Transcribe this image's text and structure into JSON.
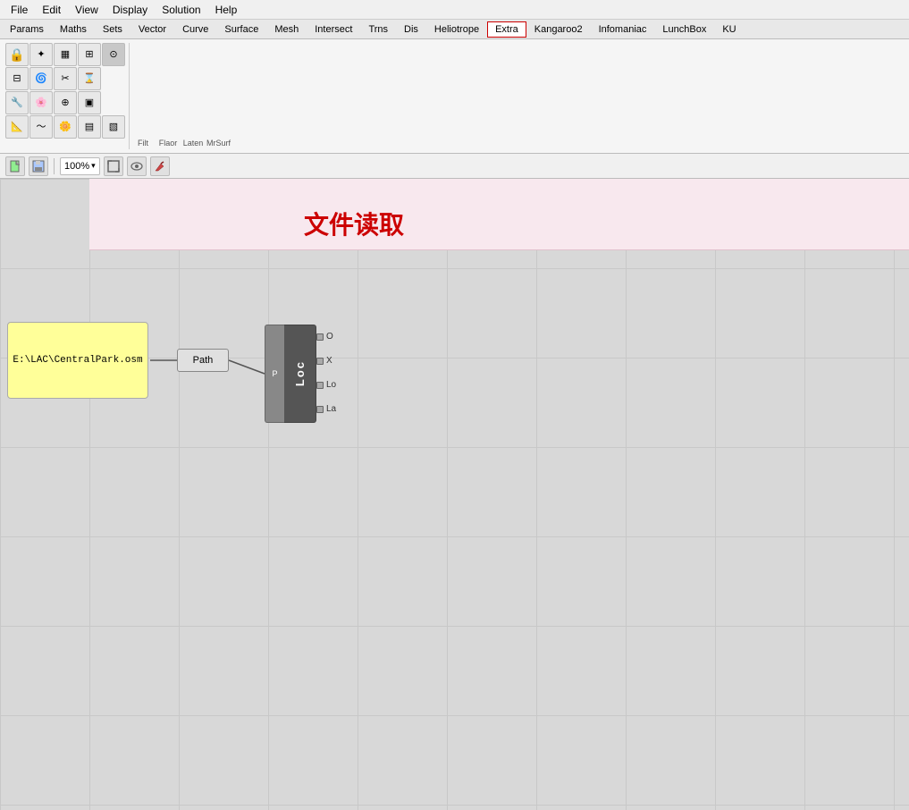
{
  "menu": {
    "items": [
      "File",
      "Edit",
      "View",
      "Display",
      "Solution",
      "Help"
    ]
  },
  "tabs": {
    "items": [
      {
        "label": "Params",
        "active": false
      },
      {
        "label": "Maths",
        "active": false
      },
      {
        "label": "Sets",
        "active": false
      },
      {
        "label": "Vector",
        "active": false
      },
      {
        "label": "Curve",
        "active": false
      },
      {
        "label": "Surface",
        "active": false
      },
      {
        "label": "Mesh",
        "active": false
      },
      {
        "label": "Intersect",
        "active": false
      },
      {
        "label": "Trns",
        "active": false
      },
      {
        "label": "Dis",
        "active": false
      },
      {
        "label": "Heliotrope",
        "active": false
      },
      {
        "label": "Extra",
        "active": true,
        "highlighted": true
      },
      {
        "label": "Kangaroo2",
        "active": false
      },
      {
        "label": "Infomaniac",
        "active": false
      },
      {
        "label": "LunchBox",
        "active": false
      },
      {
        "label": "KU",
        "active": false
      }
    ]
  },
  "toolbar": {
    "zoom_value": "100%",
    "zoom_arrow": "▾"
  },
  "canvas": {
    "annotation": "文件读取"
  },
  "nodes": {
    "file_node": {
      "text": "E:\\LAC\\CentralPark.osm"
    },
    "path_node": {
      "label": "Path"
    },
    "loc_node": {
      "left_label": "P",
      "right_label": "Loc",
      "outputs": [
        "O",
        "X",
        "Lo",
        "La"
      ]
    }
  }
}
